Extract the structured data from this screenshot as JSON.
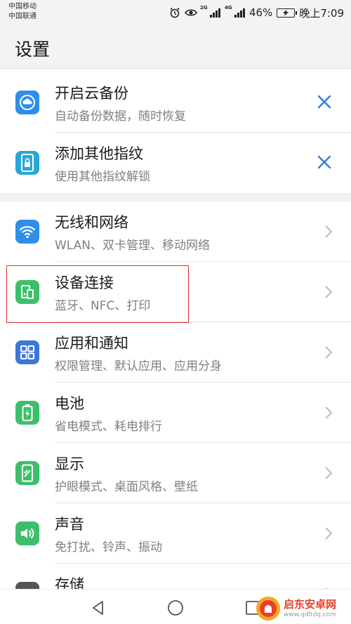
{
  "status_bar": {
    "carrier_1": "中国移动",
    "carrier_2": "中国联通",
    "network_1": "2G",
    "network_2": "4G",
    "battery_percent": "46%",
    "time": "晚上7:09"
  },
  "header": {
    "title": "设置"
  },
  "suggestions": [
    {
      "title": "开启云备份",
      "subtitle": "自动备份数据，随时恢复",
      "icon": "cloud-backup-icon",
      "icon_color": "#2f8ee8"
    },
    {
      "title": "添加其他指纹",
      "subtitle": "使用其他指纹解锁",
      "icon": "fingerprint-lock-icon",
      "icon_color": "#2aa6d6"
    }
  ],
  "settings": [
    {
      "title": "无线和网络",
      "subtitle": "WLAN、双卡管理、移动网络",
      "icon": "wifi-icon",
      "icon_color": "#2f8ee8"
    },
    {
      "title": "设备连接",
      "subtitle": "蓝牙、NFC、打印",
      "icon": "device-connect-icon",
      "icon_color": "#3dbf6a"
    },
    {
      "title": "应用和通知",
      "subtitle": "权限管理、默认应用、应用分身",
      "icon": "apps-grid-icon",
      "icon_color": "#3a78d8"
    },
    {
      "title": "电池",
      "subtitle": "省电模式、耗电排行",
      "icon": "battery-icon",
      "icon_color": "#3dbf6a"
    },
    {
      "title": "显示",
      "subtitle": "护眼模式、桌面风格、壁纸",
      "icon": "display-icon",
      "icon_color": "#3dbf6a"
    },
    {
      "title": "声音",
      "subtitle": "免打扰、铃声、振动",
      "icon": "sound-icon",
      "icon_color": "#3dbf6a"
    },
    {
      "title": "存储",
      "subtitle": "",
      "icon": "storage-icon",
      "icon_color": "#555555"
    }
  ],
  "watermark": {
    "title": "启东安卓网",
    "url": "www.qdltdq.com"
  },
  "colors": {
    "accent": "#2f7fd8",
    "highlight": "#e0302a"
  }
}
